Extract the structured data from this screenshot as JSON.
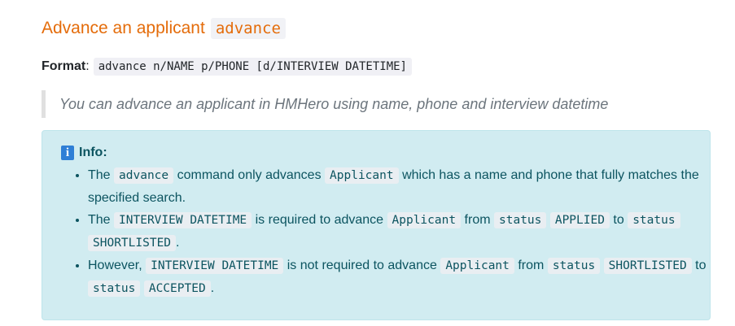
{
  "heading": {
    "text": "Advance an applicant",
    "code": "advance"
  },
  "format": {
    "label": "Format",
    "colon": ":",
    "code": "advance n/NAME p/PHONE [d/INTERVIEW DATETIME]"
  },
  "quote": "You can advance an applicant in HMHero using name, phone and interview datetime",
  "info": {
    "title": "Info:",
    "items": [
      {
        "t1": "The",
        "c1": "advance",
        "t2": "command only advances",
        "c2": "Applicant",
        "t3": "which has a name and phone that fully matches the specified search."
      },
      {
        "t1": "The",
        "c1": "INTERVIEW DATETIME",
        "t2": "is required to advance",
        "c2": "Applicant",
        "t3": "from",
        "c3": "status",
        "c4": "APPLIED",
        "t4": "to",
        "c5": "status",
        "c6": "SHORTLISTED",
        "t5": "."
      },
      {
        "t1": "However,",
        "c1": "INTERVIEW DATETIME",
        "t2": "is not required to advance",
        "c2": "Applicant",
        "t3": "from",
        "c3": "status",
        "c4": "SHORTLISTED",
        "t4": "to",
        "c5": "status",
        "c6": "ACCEPTED",
        "t5": "."
      }
    ]
  }
}
